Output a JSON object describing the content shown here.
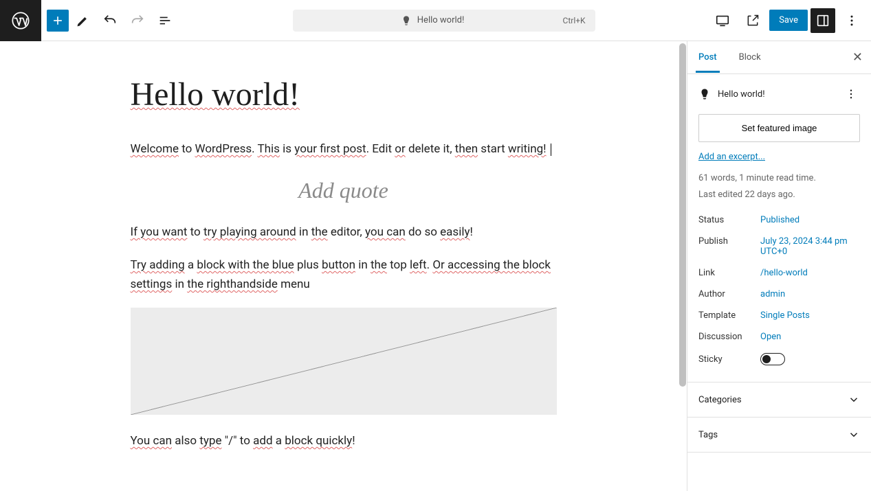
{
  "topbar": {
    "doc_title": "Hello world!",
    "shortcut": "Ctrl+K",
    "save_label": "Save"
  },
  "content": {
    "title": "Hello world!",
    "para1_parts": [
      "Welcome",
      " to ",
      "WordPress",
      ". ",
      "This",
      " is ",
      "your first post",
      ". Edit ",
      "or",
      " delete it, ",
      "then",
      " start ",
      "writing!"
    ],
    "quote_placeholder": "Add quote",
    "para2_parts": [
      "If you want",
      " to ",
      "try playing around",
      " in ",
      "the",
      " editor, ",
      "you can",
      " do so ",
      "easily",
      "!"
    ],
    "para3_parts": [
      "Try adding",
      " a ",
      "block with the blue",
      " plus ",
      "button",
      " in ",
      "the",
      " top ",
      "left",
      ". ",
      "Or accessing the block settings",
      " in ",
      "the righthandside",
      " menu"
    ],
    "para4_parts": [
      "You can",
      " also ",
      "type",
      " \"/\" to ",
      "add",
      " a ",
      "block quickly",
      "!"
    ]
  },
  "sidebar": {
    "tabs": {
      "post": "Post",
      "block": "Block"
    },
    "title": "Hello world!",
    "featured_btn": "Set featured image",
    "excerpt_link": "Add an excerpt...",
    "word_count": "61 words, 1 minute read time.",
    "last_edited": "Last edited 22 days ago.",
    "fields": {
      "status": {
        "label": "Status",
        "value": "Published"
      },
      "publish": {
        "label": "Publish",
        "value": "July 23, 2024 3:44 pm UTC+0"
      },
      "link": {
        "label": "Link",
        "value": "/hello-world"
      },
      "author": {
        "label": "Author",
        "value": "admin"
      },
      "template": {
        "label": "Template",
        "value": "Single Posts"
      },
      "discussion": {
        "label": "Discussion",
        "value": "Open"
      },
      "sticky": {
        "label": "Sticky"
      }
    },
    "categories_label": "Categories",
    "tags_label": "Tags"
  }
}
